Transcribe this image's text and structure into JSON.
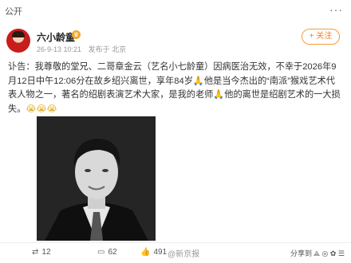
{
  "topbar": {
    "visibility": "公开",
    "more_icon": "···"
  },
  "post": {
    "username": "六小龄童",
    "meta_time": "26-9-13 10:21",
    "meta_source": "发布于 北京",
    "follow_label": "+ 关注",
    "text_part1": "讣告：我尊敬的堂兄、二哥章金云（艺名小七龄童）因病医治无效，不幸于2026年9月12日中午12:06分在故乡绍兴离世，享年84岁",
    "text_part2": "他是当今杰出的“南派”猴戏艺术代表人物之一，著名的绍剧表演艺术大家，是我的老师",
    "text_part3": "他的离世是绍剧艺术的一大损失。",
    "emojis": "😭😭😭",
    "hand_icon_text": "🙏"
  },
  "actions": {
    "repost_count": "12",
    "comment_count": "62",
    "like_count": "491",
    "watermark": "@新京报",
    "share_label": "分享到",
    "share_icons": "⟁ ◎ ✿ ☰"
  }
}
